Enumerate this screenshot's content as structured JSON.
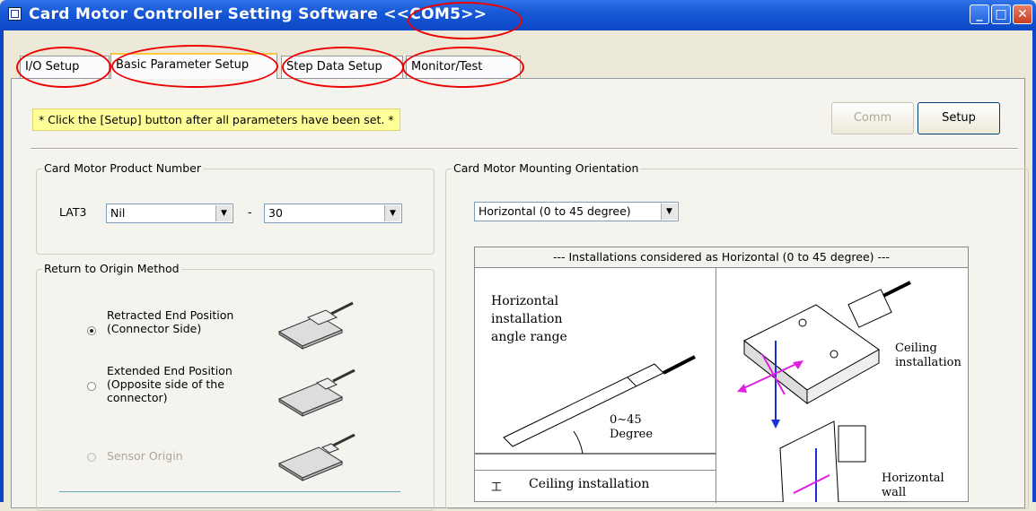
{
  "window": {
    "title": "Card Motor Controller Setting Software",
    "port": "<<COM5>>",
    "minimize": "_",
    "maximize": "□",
    "close": "✕"
  },
  "tabs": [
    {
      "label": "I/O Setup"
    },
    {
      "label": "Basic Parameter Setup"
    },
    {
      "label": "Step Data Setup"
    },
    {
      "label": "Monitor/Test"
    }
  ],
  "note": "* Click the [Setup] button after all parameters have been set. *",
  "buttons": {
    "comm": "Comm",
    "setup": "Setup"
  },
  "product": {
    "legend": "Card Motor Product Number",
    "prefix": "LAT3",
    "model_value": "Nil",
    "dash": "-",
    "stroke_value": "30"
  },
  "origin": {
    "legend": "Return to Origin Method",
    "options": [
      {
        "label_line1": "Retracted End Position",
        "label_line2": "(Connector Side)",
        "label_line3": ""
      },
      {
        "label_line1": "Extended End Position",
        "label_line2": "(Opposite side of the",
        "label_line3": "connector)"
      },
      {
        "label_line1": "Sensor Origin",
        "label_line2": "",
        "label_line3": ""
      }
    ]
  },
  "mounting": {
    "legend": "Card Motor Mounting Orientation",
    "selected": "Horizontal (0 to 45 degree)",
    "header": "--- Installations considered as Horizontal (0 to 45 degree) ---",
    "fig_horizontal": [
      "Horizontal",
      "installation",
      "angle range"
    ],
    "fig_angle": [
      "0∼45",
      "Degree"
    ],
    "fig_ceiling": [
      "Ceiling",
      "installation"
    ],
    "fig_ceiling2": "Ceiling installation",
    "fig_wall": [
      "Horizontal",
      "wall"
    ]
  },
  "colors": {
    "annotation_ring": "#e00000",
    "arrow_blue": "#1a2fd6",
    "arrow_magenta": "#e020e0"
  }
}
